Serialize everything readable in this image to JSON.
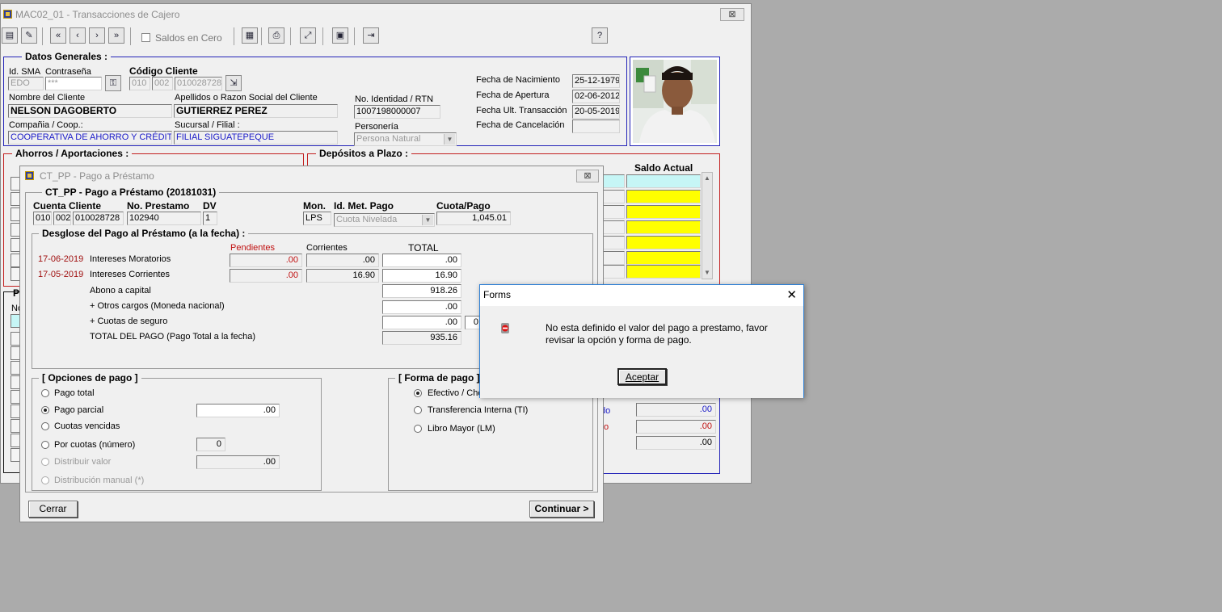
{
  "main_window": {
    "title": "MAC02_01 - Transacciones de Cajero",
    "close_label": "⊠",
    "toolbar": {
      "saldos_cero_label": "Saldos en Cero",
      "help_label": "?"
    },
    "datos_generales": {
      "legend": "Datos Generales :",
      "id_sma_label": "Id. SMA",
      "contrasena_label": "Contraseña",
      "id_sma_value": "EDO",
      "contrasena_value": "***",
      "codigo_cliente_label": "Código Cliente",
      "codigo_parts": [
        "010",
        "002",
        "010028728"
      ],
      "nombre_label": "Nombre del Cliente",
      "nombre_value": "NELSON DAGOBERTO",
      "apellidos_label": "Apellidos o Razon Social del Cliente",
      "apellidos_value": "GUTIERREZ PEREZ",
      "identidad_label": "No. Identidad / RTN",
      "identidad_value": "1007198000007",
      "compania_label": "Compañia / Coop.:",
      "compania_value": "COOPERATIVA DE AHORRO Y CRÉDITO",
      "sucursal_label": "Sucursal / Filial :",
      "sucursal_value": "FILIAL SIGUATEPEQUE",
      "personeria_label": "Personería",
      "personeria_value": "Persona Natural",
      "fecha_nacimiento_label": "Fecha de Nacimiento",
      "fecha_nacimiento_value": "25-12-1979",
      "fecha_apertura_label": "Fecha de  Apertura",
      "fecha_apertura_value": "02-06-2012",
      "fecha_ult_label": "Fecha Ult. Transacción",
      "fecha_ult_value": "20-05-2019",
      "fecha_cancel_label": "Fecha de Cancelación"
    },
    "ahorros_legend": "Ahorros / Aportaciones :",
    "depositos_legend": "Depósitos a Plazo :",
    "saldo_actual_label": "Saldo Actual",
    "right_values": [
      ".00",
      ".00",
      ".00"
    ]
  },
  "loan_dialog": {
    "title": "CT_PP - Pago a Préstamo",
    "close_label": "⊠",
    "group_title": "CT_PP - Pago a Préstamo (20181031)",
    "cuenta_cliente_label": "Cuenta Cliente",
    "cuenta_parts": [
      "010",
      "002",
      "010028728"
    ],
    "no_prestamo_label": "No. Prestamo",
    "no_prestamo_value": "102940",
    "dv_label": "DV",
    "dv_value": "1",
    "mon_label": "Mon.",
    "mon_value": "LPS",
    "met_pago_label": "Id. Met. Pago",
    "met_pago_value": "Cuota Nivelada",
    "cuota_label": "Cuota/Pago",
    "cuota_value": "1,045.01",
    "desglose_legend": "Desglose del Pago al Préstamo (a la fecha) :",
    "col_pendientes": "Pendientes",
    "col_corrientes": "Corrientes",
    "col_total": "TOTAL",
    "rows": [
      {
        "date": "17-06-2019",
        "label": "Intereses Moratorios",
        "pend": ".00",
        "corr": ".00",
        "total": ".00"
      },
      {
        "date": "17-05-2019",
        "label": "Intereses Corrientes",
        "pend": ".00",
        "corr": "16.90",
        "total": "16.90"
      },
      {
        "label": "Abono a capital",
        "total": "918.26"
      },
      {
        "label": "+ Otros cargos (Moneda nacional)",
        "total": ".00"
      },
      {
        "label": "+ Cuotas de seguro",
        "total": ".00",
        "extra": "0"
      },
      {
        "label": "TOTAL DEL PAGO (Pago Total a la fecha)",
        "total": "935.16"
      }
    ],
    "opciones_legend": "[ Opciones de pago ]",
    "opciones": {
      "pago_total": "Pago total",
      "pago_parcial": "Pago parcial",
      "pago_parcial_value": ".00",
      "cuotas_vencidas": "Cuotas vencidas",
      "por_cuotas": "Por cuotas (número)",
      "por_cuotas_value": "0",
      "distribuir_valor": "Distribuir valor",
      "distribuir_value": ".00",
      "distribucion_manual": "Distribución manual (*)"
    },
    "forma_legend": "[ Forma de pago ]",
    "forma": {
      "efectivo": "Efectivo / Che",
      "transferencia": "Transferencia Interna (TI)",
      "libro_mayor": "Libro Mayor (LM)"
    },
    "cerrar_label": "Cerrar",
    "continuar_label": "Continuar >"
  },
  "msg_dialog": {
    "title": "Forms",
    "close_label": "✕",
    "message_line1": "No esta definido el valor del pago a prestamo, favor",
    "message_line2": "revisar la opción y forma de pago.",
    "ok_label": "Aceptar"
  },
  "partial_labels": {
    "p_label": "P",
    "no_label": "No",
    "do_label": "do",
    "o_label": "o"
  }
}
